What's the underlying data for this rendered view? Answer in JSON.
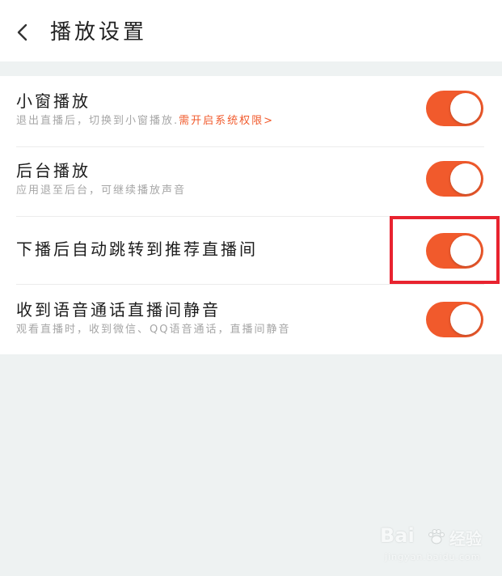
{
  "header": {
    "title": "播放设置",
    "back_icon": "chevron-left-icon"
  },
  "colors": {
    "toggle_on": "#f15a2c",
    "link": "#f15a2c",
    "highlight": "#e8232f",
    "background": "#eef2f2"
  },
  "settings": [
    {
      "title": "小窗播放",
      "subtitle": "退出直播后，切换到小窗播放.",
      "link": "需开启系统权限>",
      "enabled": true
    },
    {
      "title": "后台播放",
      "subtitle": "应用退至后台，可继续播放声音",
      "enabled": true
    },
    {
      "title": "下播后自动跳转到推荐直播间",
      "enabled": true
    },
    {
      "title": "收到语音通话直播间静音",
      "subtitle": "观看直播时，收到微信、QQ语音通话，直播间静音",
      "enabled": true
    }
  ],
  "watermark": {
    "logo": "Bai",
    "logo_suffix": "经验",
    "url": "jingyan.baidu.com"
  }
}
